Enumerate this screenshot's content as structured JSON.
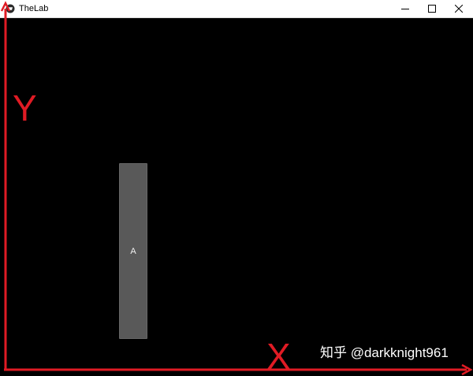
{
  "window": {
    "title": "TheLab",
    "controls": {
      "minimize_icon": "minimize-icon",
      "maximize_icon": "maximize-icon",
      "close_icon": "close-icon"
    },
    "background_color": "#000000"
  },
  "canvas": {
    "button": {
      "label": "A",
      "color": "#595959"
    }
  },
  "annotations": {
    "y_axis_label": "Y",
    "x_axis_label": "X",
    "color": "#e01b24"
  },
  "watermark": {
    "text": "知乎 @darkknight961"
  }
}
